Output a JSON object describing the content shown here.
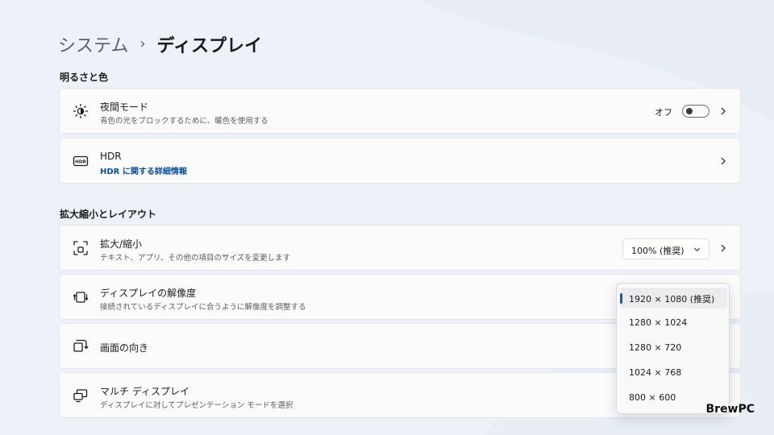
{
  "breadcrumb": {
    "parent": "システム",
    "separator": "›",
    "current": "ディスプレイ"
  },
  "sections": {
    "brightness": "明るさと色",
    "scale_layout": "拡大縮小とレイアウト"
  },
  "night_mode": {
    "title": "夜間モード",
    "subtitle": "青色の光をブロックするために、暖色を使用する",
    "toggle_label": "オフ",
    "toggle_on": false
  },
  "hdr": {
    "title": "HDR",
    "link": "HDR に関する詳細情報"
  },
  "scale": {
    "title": "拡大/縮小",
    "subtitle": "テキスト、アプリ、その他の項目のサイズを変更します",
    "value": "100% (推奨)"
  },
  "resolution": {
    "title": "ディスプレイの解像度",
    "subtitle": "接続されているディスプレイに合うように解像度を調整する"
  },
  "orientation": {
    "title": "画面の向き"
  },
  "multi_display": {
    "title": "マルチ ディスプレイ",
    "subtitle": "ディスプレイに対してプレゼンテーション モードを選択"
  },
  "resolution_dropdown": {
    "options": [
      "1920 × 1080 (推奨)",
      "1280 × 1024",
      "1280 × 720",
      "1024 × 768",
      "800 × 600"
    ],
    "selected_index": 0
  },
  "brand": "BrewPC",
  "colors": {
    "accent": "#0063b1",
    "link": "#0a4f98",
    "background": "#eef1f7",
    "card": "#fbfbfc"
  },
  "icons": {
    "night_mode": "brightness-icon",
    "hdr": "hdr-icon",
    "scale": "scale-icon",
    "resolution": "resolution-icon",
    "orientation": "orientation-icon",
    "multi_display": "multi-display-icon"
  }
}
